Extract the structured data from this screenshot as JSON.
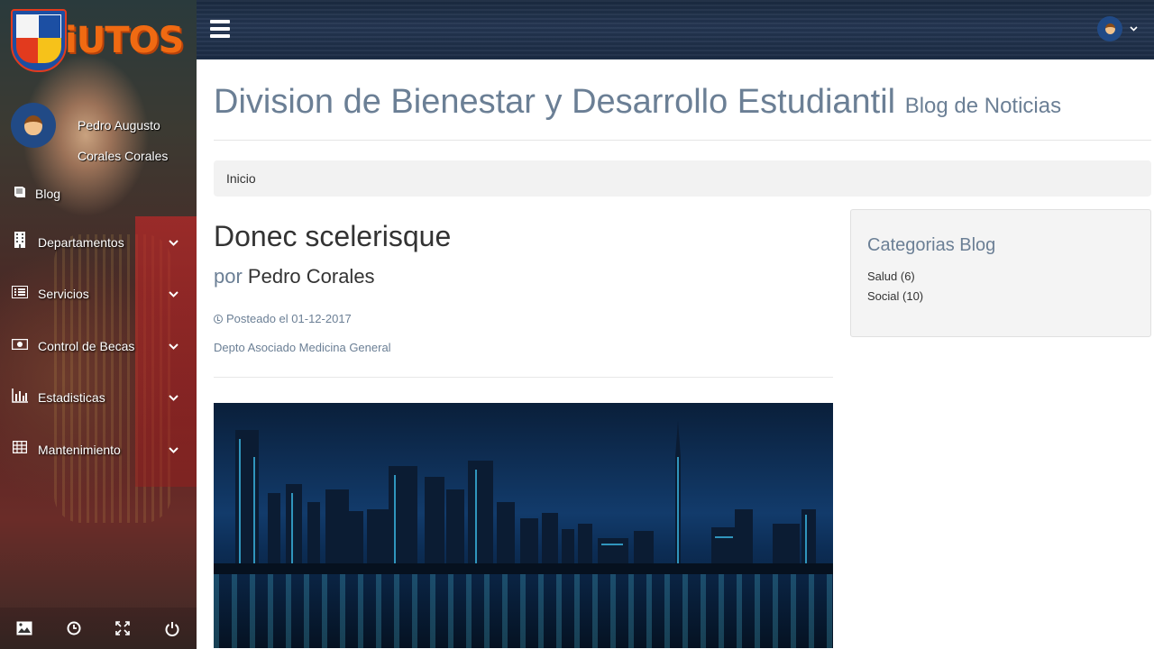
{
  "logo": {
    "text": "iUTOS"
  },
  "user": {
    "first_line": "Pedro Augusto",
    "second_line": "Corales Corales"
  },
  "sidebar": {
    "items": [
      {
        "label": "Blog",
        "icon": "book-icon",
        "has_chevron": false
      },
      {
        "label": "Departamentos",
        "icon": "building-icon",
        "has_chevron": true
      },
      {
        "label": "Servicios",
        "icon": "list-icon",
        "has_chevron": true
      },
      {
        "label": "Control de Becas",
        "icon": "money-icon",
        "has_chevron": true
      },
      {
        "label": "Estadisticas",
        "icon": "bar-chart-icon",
        "has_chevron": true
      },
      {
        "label": "Mantenimiento",
        "icon": "table-icon",
        "has_chevron": true
      }
    ],
    "footer_icons": [
      "picture-icon",
      "clock-icon",
      "fullscreen-icon",
      "power-icon"
    ]
  },
  "header": {
    "title": "Division de Bienestar y Desarrollo Estudiantil",
    "subtitle": "Blog de Noticias"
  },
  "breadcrumb": {
    "label": "Inicio"
  },
  "post": {
    "title": "Donec scelerisque",
    "by_label": "por",
    "author": "Pedro Corales",
    "posted": "Posteado el 01-12-2017",
    "department": "Depto Asociado Medicina General"
  },
  "categories": {
    "title": "Categorias Blog",
    "items": [
      "Salud (6)",
      "Social (10)"
    ]
  },
  "colors": {
    "muted_blue": "#6b7f95",
    "topbar": "#243652",
    "logo_orange": "#f06a12"
  }
}
